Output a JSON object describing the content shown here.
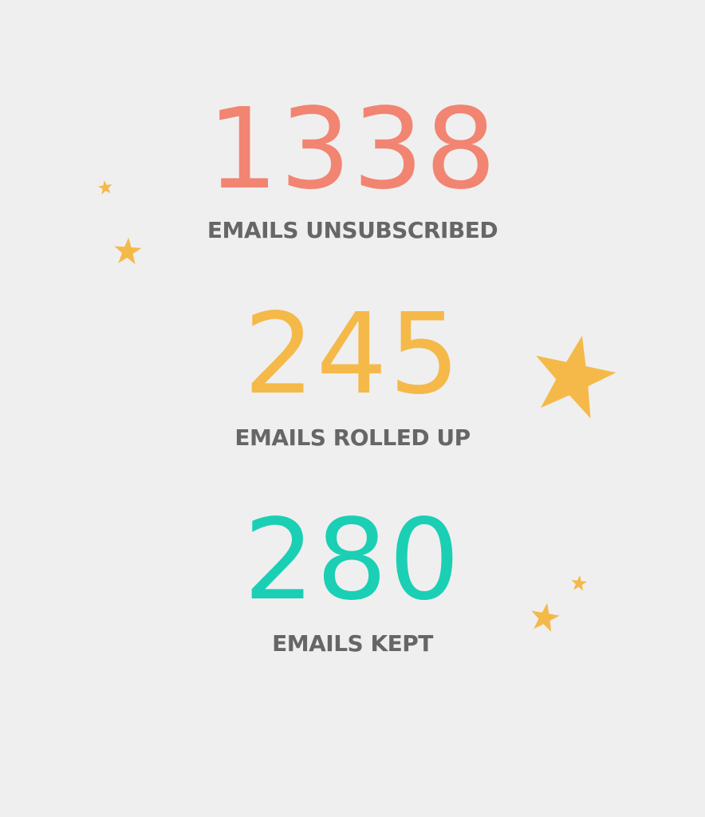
{
  "colors": {
    "background": "#efefef",
    "label": "#666666",
    "star": "#f5b94a"
  },
  "stats": {
    "unsubscribed": {
      "value": "1338",
      "label": "EMAILS UNSUBSCRIBED",
      "color": "#f28472"
    },
    "rolled_up": {
      "value": "245",
      "label": "EMAILS ROLLED UP",
      "color": "#f5b94a"
    },
    "kept": {
      "value": "280",
      "label": "EMAILS KEPT",
      "color": "#1bcfb4"
    }
  },
  "decorations": {
    "icon": "star-icon"
  }
}
